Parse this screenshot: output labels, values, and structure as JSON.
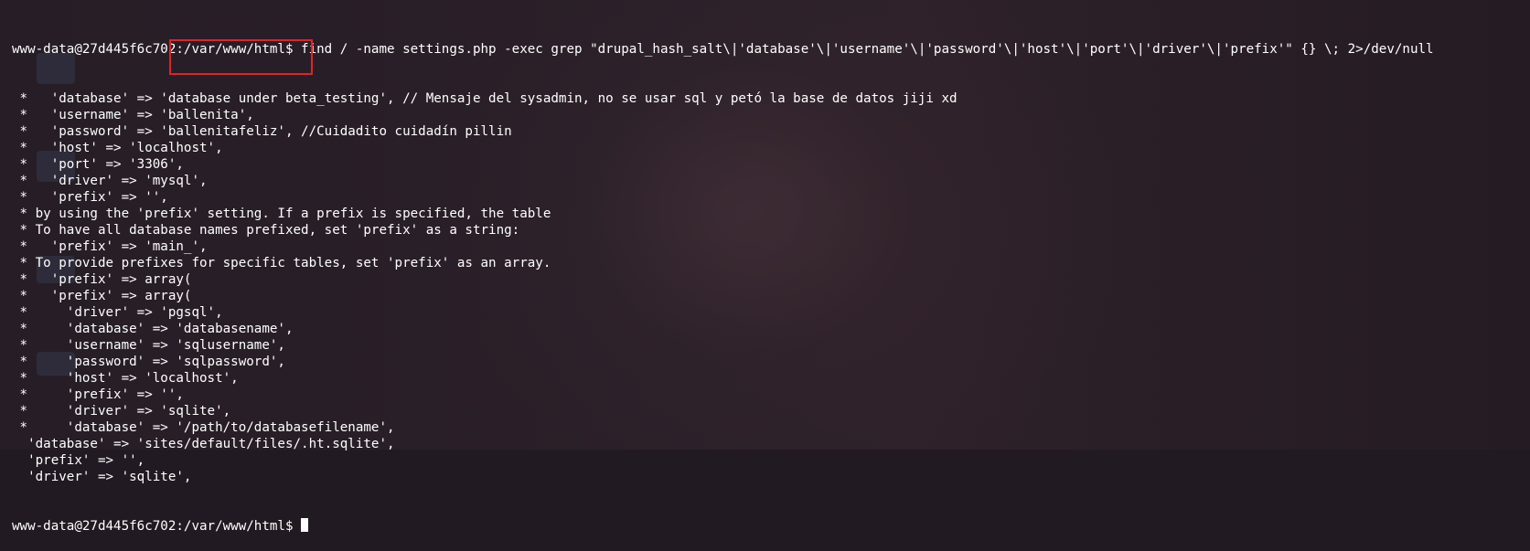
{
  "terminal": {
    "prompt": "www-data@27d445f6c702:/var/www/html$",
    "command": "find / -name settings.php -exec grep \"drupal_hash_salt\\|'database'\\|'username'\\|'password'\\|'host'\\|'port'\\|'driver'\\|'prefix'\" {} \\; 2>/dev/null",
    "output_lines": [
      " *   'database' => 'database under beta_testing', // Mensaje del sysadmin, no se usar sql y petó la base de datos jiji xd",
      " *   'username' => 'ballenita',",
      " *   'password' => 'ballenitafeliz', //Cuidadito cuidadín pillin",
      " *   'host' => 'localhost',",
      " *   'port' => '3306',",
      " *   'driver' => 'mysql',",
      " *   'prefix' => '',",
      " * by using the 'prefix' setting. If a prefix is specified, the table",
      " * To have all database names prefixed, set 'prefix' as a string:",
      " *   'prefix' => 'main_',",
      " * To provide prefixes for specific tables, set 'prefix' as an array.",
      " *   'prefix' => array(",
      " *   'prefix' => array(",
      " *     'driver' => 'pgsql',",
      " *     'database' => 'databasename',",
      " *     'username' => 'sqlusername',",
      " *     'password' => 'sqlpassword',",
      " *     'host' => 'localhost',",
      " *     'prefix' => '',",
      " *     'driver' => 'sqlite',",
      " *     'database' => '/path/to/databasefilename',",
      "  'database' => 'sites/default/files/.ht.sqlite',",
      "  'prefix' => '',",
      "  'driver' => 'sqlite',"
    ],
    "final_prompt": "www-data@27d445f6c702:/var/www/html$ "
  },
  "colors": {
    "text": "#ffffff",
    "highlight_border": "#e0222b",
    "background": "#2b2029"
  }
}
